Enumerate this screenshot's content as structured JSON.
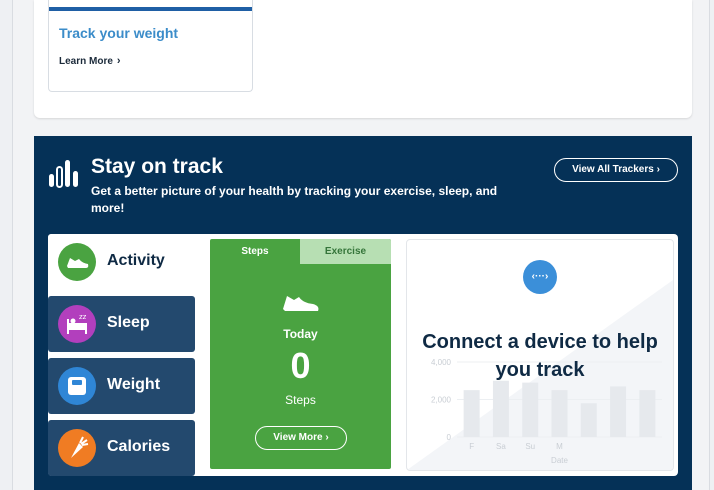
{
  "weight_card": {
    "title": "Track your weight",
    "learn_more": "Learn More",
    "chevron": "›"
  },
  "track": {
    "title": "Stay on track",
    "subtitle": "Get a better picture of your health by tracking your exercise, sleep, and more!",
    "view_all": "View All Trackers ›",
    "icon": "bar-chart-icon"
  },
  "trackers": [
    {
      "label": "Activity",
      "icon": "shoe-icon",
      "color": "#4aa341",
      "active": true
    },
    {
      "label": "Sleep",
      "icon": "bed-icon",
      "color": "#b23fbd",
      "active": false
    },
    {
      "label": "Weight",
      "icon": "scale-icon",
      "color": "#2f86d6",
      "active": false
    },
    {
      "label": "Calories",
      "icon": "carrot-icon",
      "color": "#f07c23",
      "active": false
    }
  ],
  "steps_card": {
    "tabs": [
      "Steps",
      "Exercise"
    ],
    "today": "Today",
    "count": "0",
    "unit": "Steps",
    "view_more": "View More ›"
  },
  "chart_card": {
    "connect_text": "Connect a device to help you track",
    "link_icon": "link-icon"
  },
  "chart_data": {
    "type": "bar",
    "categories": [
      "F",
      "Sa",
      "Su",
      "M",
      "",
      "",
      ""
    ],
    "values": [
      2500,
      3000,
      2900,
      2500,
      1800,
      2700,
      2500
    ],
    "xlabel": "Date",
    "ylabel": "",
    "yticks": [
      "0",
      "2,000",
      "4,000"
    ],
    "ylim": [
      0,
      4000
    ],
    "grid": true
  }
}
